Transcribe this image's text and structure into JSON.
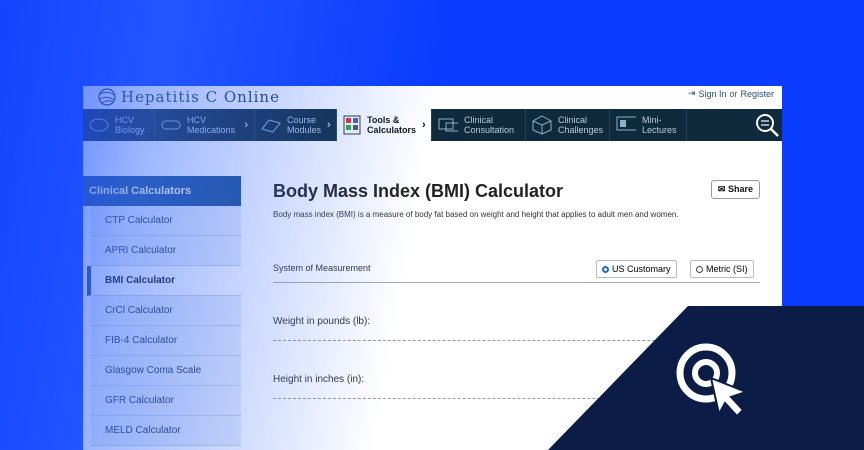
{
  "site": {
    "logo_text": "Hepatitis C Online",
    "sign_in": "Sign In",
    "or": "or",
    "register": "Register"
  },
  "nav": [
    {
      "label": "HCV Biology",
      "icon": "liver-icon"
    },
    {
      "label": "HCV Medications",
      "icon": "pills-icon"
    },
    {
      "label": "Course Modules",
      "icon": "book-icon"
    },
    {
      "label": "Tools & Calculators",
      "icon": "calculator-icon"
    },
    {
      "label": "Clinical Consultation",
      "icon": "chat-icon"
    },
    {
      "label": "Clinical Challenges",
      "icon": "cube-icon"
    },
    {
      "label": "Mini-Lectures",
      "icon": "presentation-icon"
    }
  ],
  "sidebar": {
    "heading": "Clinical Calculators",
    "items": [
      "CTP Calculator",
      "APRI Calculator",
      "BMI Calculator",
      "CrCl Calculator",
      "FIB-4 Calculator",
      "Glasgow Coma Scale",
      "GFR Calculator",
      "MELD Calculator"
    ],
    "active": "BMI Calculator"
  },
  "main": {
    "title": "Body Mass Index (BMI) Calculator",
    "share": "Share",
    "description": "Body mass index (BMI) is a measure of body fat based on weight and height that applies to adult men and women.",
    "system_label": "System of Measurement",
    "option_us": "US Customary",
    "option_metric": "Metric (SI)",
    "selected_option": "US Customary",
    "weight_label": "Weight in pounds (lb):",
    "height_label": "Height in inches (in):"
  },
  "colors": {
    "background": "#0a3cff",
    "nav_bg": "#0e2a3c",
    "sidebar_head": "#1c4f8e",
    "corner": "#0b1d47"
  }
}
